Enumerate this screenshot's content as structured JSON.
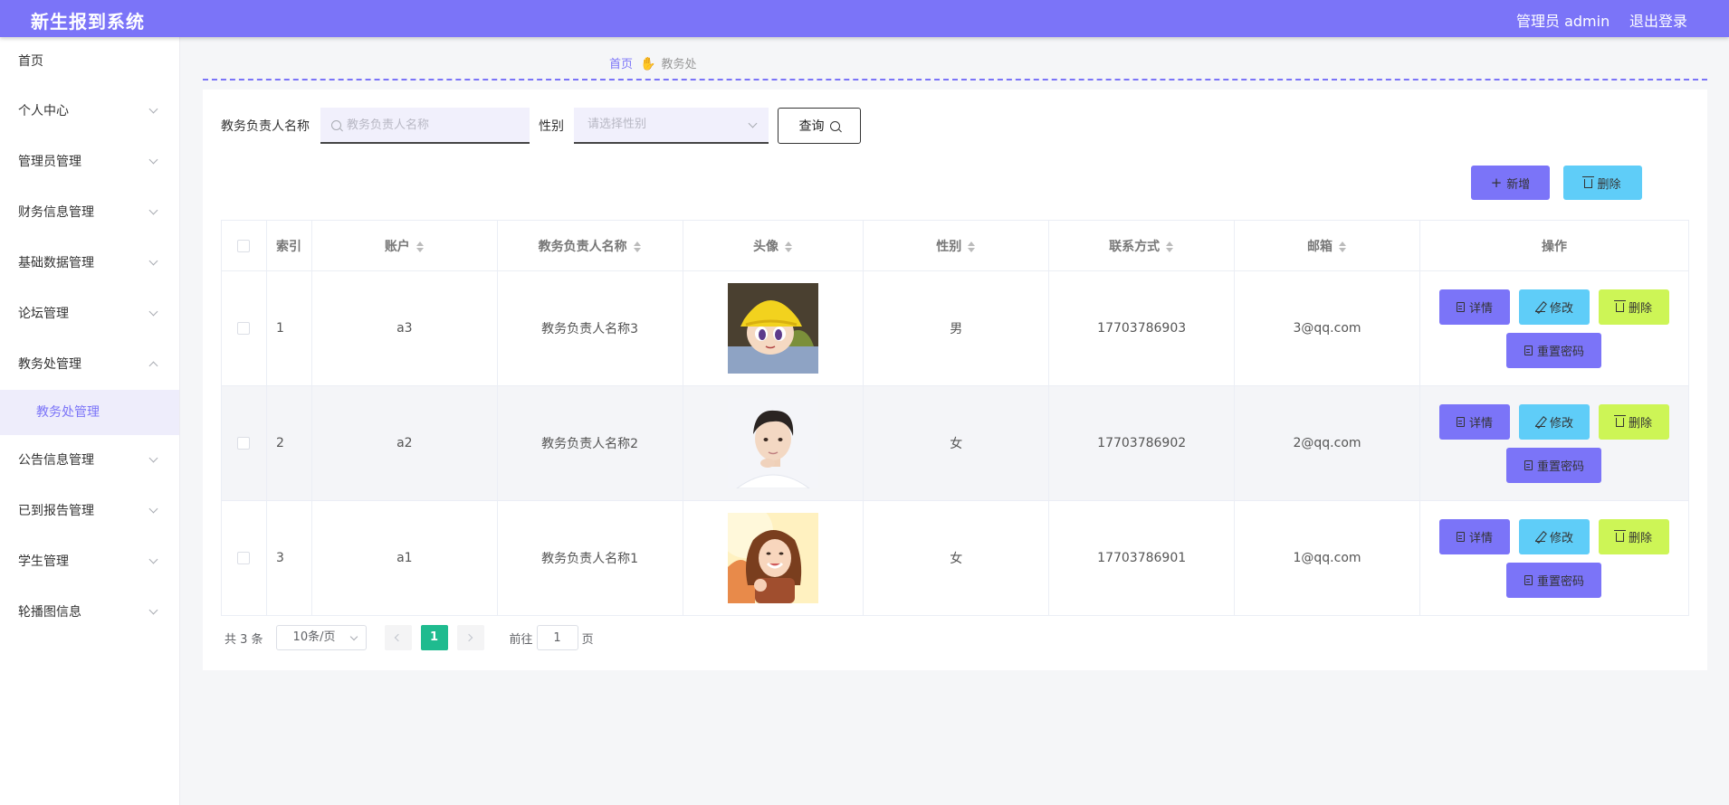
{
  "app": {
    "title": "新生报到系统",
    "admin_label": "管理员 admin",
    "logout_label": "退出登录",
    "accent": "#7b74f8"
  },
  "sidebar": {
    "items": [
      {
        "label": "首页"
      },
      {
        "label": "个人中心"
      },
      {
        "label": "管理员管理"
      },
      {
        "label": "财务信息管理"
      },
      {
        "label": "基础数据管理"
      },
      {
        "label": "论坛管理"
      },
      {
        "label": "教务处管理"
      },
      {
        "label": "公告信息管理"
      },
      {
        "label": "已到报告管理"
      },
      {
        "label": "学生管理"
      },
      {
        "label": "轮播图信息"
      }
    ],
    "active_sub": {
      "label": "教务处管理"
    }
  },
  "breadcrumb": {
    "home": "首页",
    "current": "教务处"
  },
  "search": {
    "name_label": "教务负责人名称",
    "name_placeholder": "教务负责人名称",
    "gender_label": "性别",
    "gender_placeholder": "请选择性别",
    "query_label": "查询"
  },
  "actions": {
    "add_label": "新增",
    "delete_label": "删除"
  },
  "table": {
    "headers": {
      "index": "索引",
      "account": "账户",
      "name": "教务负责人名称",
      "avatar": "头像",
      "gender": "性别",
      "phone": "联系方式",
      "email": "邮箱",
      "ops": "操作"
    },
    "rows": [
      {
        "index": "1",
        "account": "a3",
        "name": "教务负责人名称3",
        "avatar": "anime-avatar",
        "gender": "男",
        "phone": "17703786903",
        "email": "3@qq.com"
      },
      {
        "index": "2",
        "account": "a2",
        "name": "教务负责人名称2",
        "avatar": "male-portrait",
        "gender": "女",
        "phone": "17703786902",
        "email": "2@qq.com"
      },
      {
        "index": "3",
        "account": "a1",
        "name": "教务负责人名称1",
        "avatar": "female-portrait",
        "gender": "女",
        "phone": "17703786901",
        "email": "1@qq.com"
      }
    ],
    "row_ops": {
      "detail": "详情",
      "edit": "修改",
      "delete": "删除",
      "reset": "重置密码"
    }
  },
  "pagination": {
    "total": "共 3 条",
    "page_size": "10条/页",
    "current_page": "1",
    "goto_prefix": "前往",
    "goto_value": "1",
    "goto_suffix": "页"
  }
}
